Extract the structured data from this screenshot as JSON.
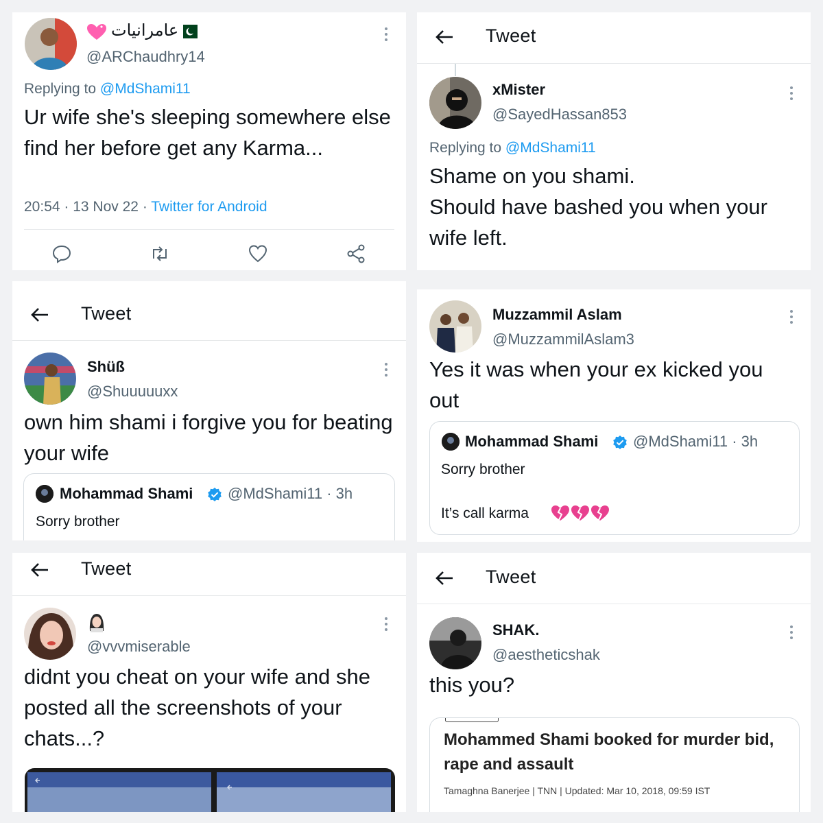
{
  "panels": {
    "p1": {
      "name": "عامرانیات",
      "handle": "@ARChaudhry14",
      "replying_prefix": "Replying to",
      "replying_to": "@MdShami11",
      "body": "Ur wife she's sleeping somewhere else find her before get any Karma...",
      "time": "20:54",
      "date": "13 Nov 22",
      "source": "Twitter for Android",
      "actions": [
        "reply-icon",
        "retweet-icon",
        "like-icon",
        "share-icon"
      ]
    },
    "p2": {
      "header_title": "Tweet",
      "name": "xMister",
      "handle": "@SayedHassan853",
      "replying_prefix": "Replying to",
      "replying_to": "@MdShami11",
      "body_line1": "Shame on you shami.",
      "body_line2": "Should have bashed you when your wife left."
    },
    "p3": {
      "header_title": "Tweet",
      "name": "Shüß",
      "handle": "@Shuuuuuxx",
      "body": "own him shami i forgive you for beating your wife",
      "quote": {
        "name": "Mohammad Shami",
        "handle": "@MdShami11",
        "time": "3h",
        "text": "Sorry brother"
      }
    },
    "p4": {
      "name": "Muzzammil Aslam",
      "handle": "@MuzzammilAslam3",
      "body": "Yes it was when your ex kicked you out",
      "quote": {
        "name": "Mohammad Shami",
        "handle": "@MdShami11",
        "time": "3h",
        "text": "Sorry brother",
        "text2": "It’s call karma"
      }
    },
    "p5": {
      "header_title": "Tweet",
      "handle": "@vvvmiserable",
      "body": "didnt you cheat on your wife and she posted all the screenshots of your chats...?"
    },
    "p6": {
      "header_title": "Tweet",
      "name": "SHAK.",
      "handle": "@aestheticshak",
      "body": "this you?",
      "article": {
        "title": "Mohammed Shami booked for murder bid, rape and assault",
        "meta": "Tamaghna Banerjee | TNN | Updated: Mar 10, 2018, 09:59 IST"
      }
    }
  },
  "colors": {
    "link": "#1d9bf0",
    "secondary_text": "#536471",
    "verified": "#1d9bf0",
    "broken_heart": "#e8408f",
    "divider": "#e6e8ea"
  }
}
